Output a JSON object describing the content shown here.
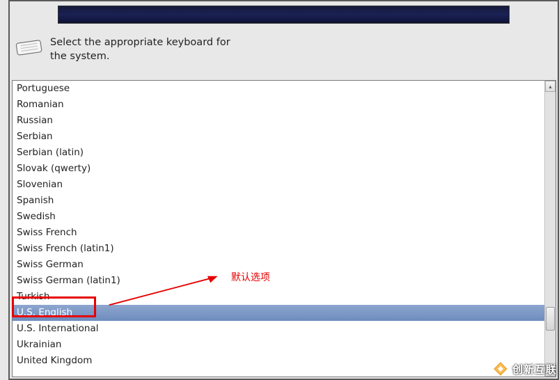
{
  "instruction": {
    "line1": "Select the appropriate keyboard for",
    "line2": "the system."
  },
  "keyboard_list": {
    "items": [
      {
        "label": "Portuguese",
        "selected": false
      },
      {
        "label": "Romanian",
        "selected": false
      },
      {
        "label": "Russian",
        "selected": false
      },
      {
        "label": "Serbian",
        "selected": false
      },
      {
        "label": "Serbian (latin)",
        "selected": false
      },
      {
        "label": "Slovak (qwerty)",
        "selected": false
      },
      {
        "label": "Slovenian",
        "selected": false
      },
      {
        "label": "Spanish",
        "selected": false
      },
      {
        "label": "Swedish",
        "selected": false
      },
      {
        "label": "Swiss French",
        "selected": false
      },
      {
        "label": "Swiss French (latin1)",
        "selected": false
      },
      {
        "label": "Swiss German",
        "selected": false
      },
      {
        "label": "Swiss German (latin1)",
        "selected": false
      },
      {
        "label": "Turkish",
        "selected": false
      },
      {
        "label": "U.S. English",
        "selected": true
      },
      {
        "label": "U.S. International",
        "selected": false
      },
      {
        "label": "Ukrainian",
        "selected": false
      },
      {
        "label": "United Kingdom",
        "selected": false
      }
    ]
  },
  "annotation": {
    "label": "默认选项",
    "color": "#e60000"
  },
  "watermark": {
    "text": "创新互联"
  },
  "scroll": {
    "up_glyph": "▴",
    "down_glyph": "▾"
  }
}
